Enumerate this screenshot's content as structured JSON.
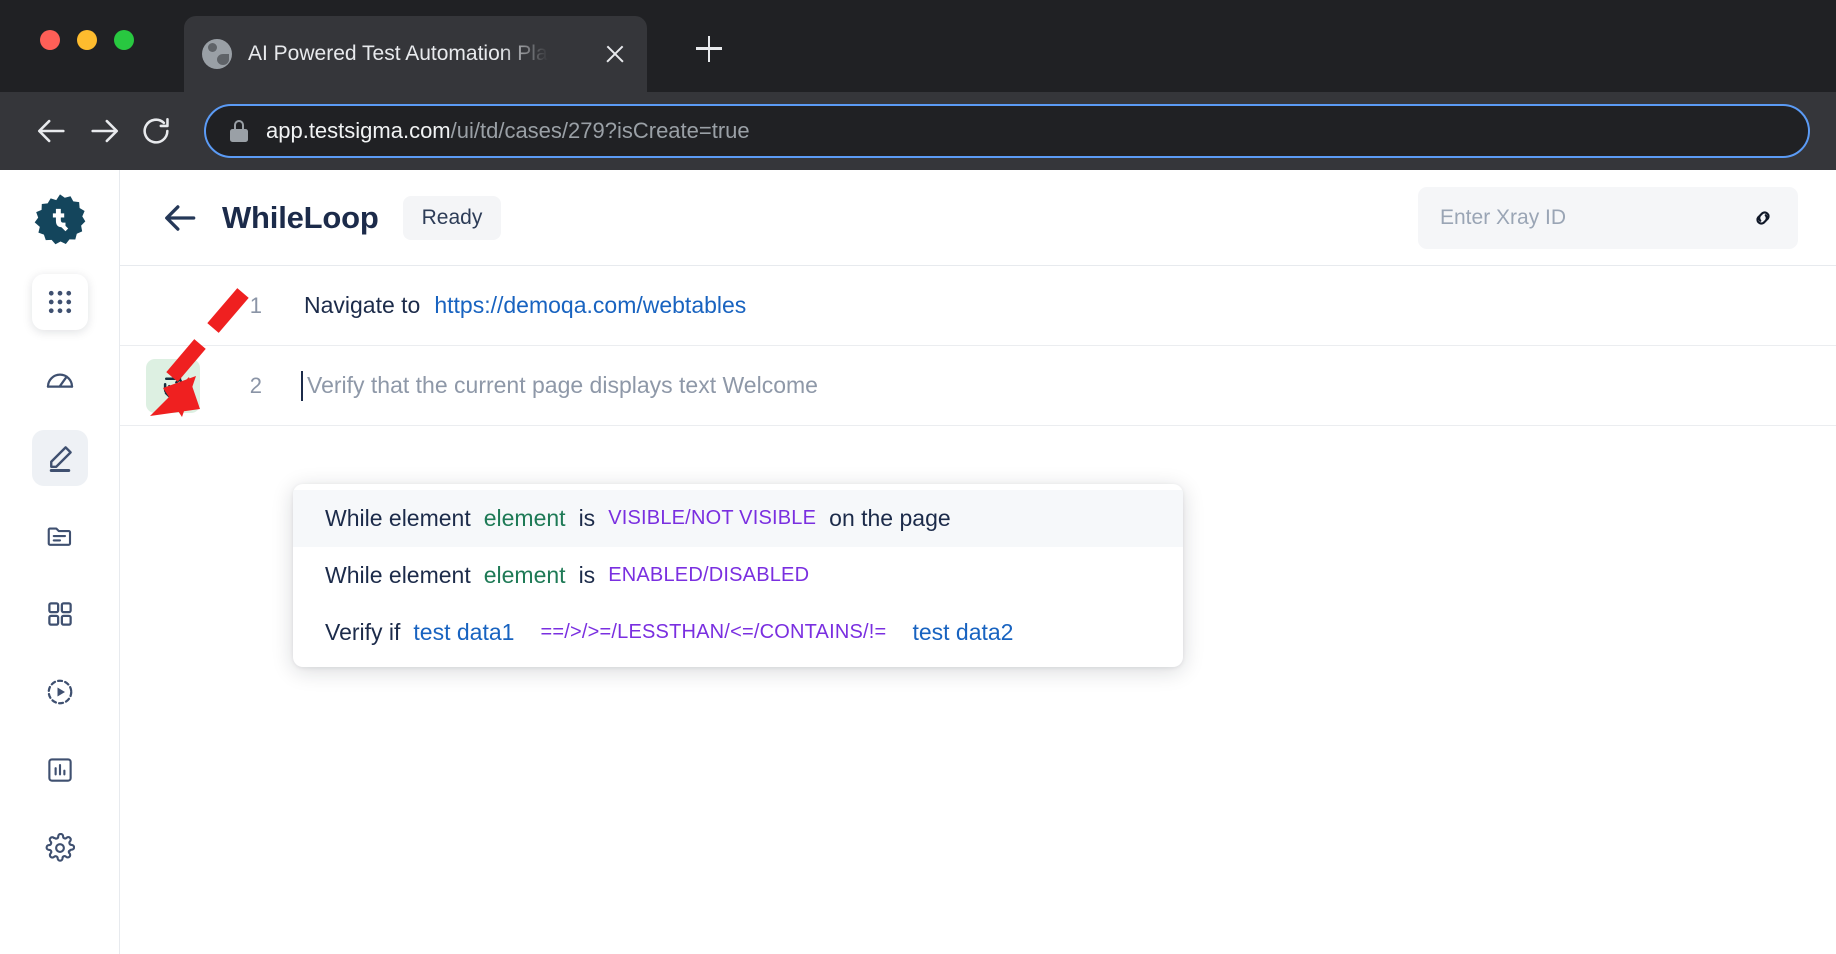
{
  "browser": {
    "tab": {
      "title": "AI Powered Test Automation Pla",
      "favicon": "globe-icon",
      "close": "close-icon"
    },
    "new_tab_label": "+",
    "nav": {
      "back": "back-arrow-icon",
      "forward": "forward-arrow-icon",
      "reload": "reload-icon"
    },
    "omnibox": {
      "lock": "lock-icon",
      "host": "app.testsigma.com",
      "path": "/ui/td/cases/279?isCreate=true"
    }
  },
  "sidebar": {
    "logo": "testsigma-logo",
    "items": [
      {
        "name": "apps-grid",
        "icon": "apps-grid-icon"
      },
      {
        "name": "dashboard",
        "icon": "speedometer-icon"
      },
      {
        "name": "create-tests",
        "icon": "pencil-icon",
        "active": true
      },
      {
        "name": "test-plans",
        "icon": "folder-icon"
      },
      {
        "name": "test-suites",
        "icon": "grid-squares-icon"
      },
      {
        "name": "runs",
        "icon": "play-circle-icon"
      },
      {
        "name": "reports",
        "icon": "bar-chart-icon"
      },
      {
        "name": "settings",
        "icon": "gear-icon"
      }
    ]
  },
  "header": {
    "back": "back-arrow-icon",
    "title": "WhileLoop",
    "status": "Ready",
    "xray": {
      "placeholder": "Enter Xray ID",
      "value": "",
      "icon": "link-icon"
    }
  },
  "steps": [
    {
      "number": "1",
      "action": "Navigate to",
      "value": "https://demoqa.com/webtables",
      "loop": false
    },
    {
      "number": "2",
      "placeholder": "Verify that the current page displays text Welcome",
      "loop": true,
      "loop_icon": "loop-icon"
    }
  ],
  "suggestions": [
    {
      "highlight": true,
      "parts": [
        {
          "text": "While element",
          "style": "plain"
        },
        {
          "text": "element",
          "style": "green"
        },
        {
          "text": "is",
          "style": "plain"
        },
        {
          "text": "VISIBLE/NOT VISIBLE",
          "style": "purple"
        },
        {
          "text": "on the page",
          "style": "plain"
        }
      ]
    },
    {
      "highlight": false,
      "parts": [
        {
          "text": "While element",
          "style": "plain"
        },
        {
          "text": "element",
          "style": "green"
        },
        {
          "text": "is",
          "style": "plain"
        },
        {
          "text": "ENABLED/DISABLED",
          "style": "purple"
        }
      ]
    },
    {
      "highlight": false,
      "parts": [
        {
          "text": "Verify if",
          "style": "plain"
        },
        {
          "text": "test data1",
          "style": "blue-wide"
        },
        {
          "text": "==/>/>=/LESSTHAN/<=/CONTAINS/!=",
          "style": "purple-wide"
        },
        {
          "text": "test data2",
          "style": "blue"
        }
      ]
    }
  ],
  "annotation": {
    "type": "red-dashed-arrow",
    "color": "#ef2020",
    "points_to": "loop-icon-step-2"
  },
  "colors": {
    "chrome_bg": "#202124",
    "chrome_tab": "#35363a",
    "omnibox_focus": "#5b9bf5",
    "accent_link": "#1863c0",
    "green": "#1e7a56",
    "purple": "#7a2fe0",
    "loop_chip_bg": "#ddf0e2",
    "title": "#1c2b4a"
  }
}
